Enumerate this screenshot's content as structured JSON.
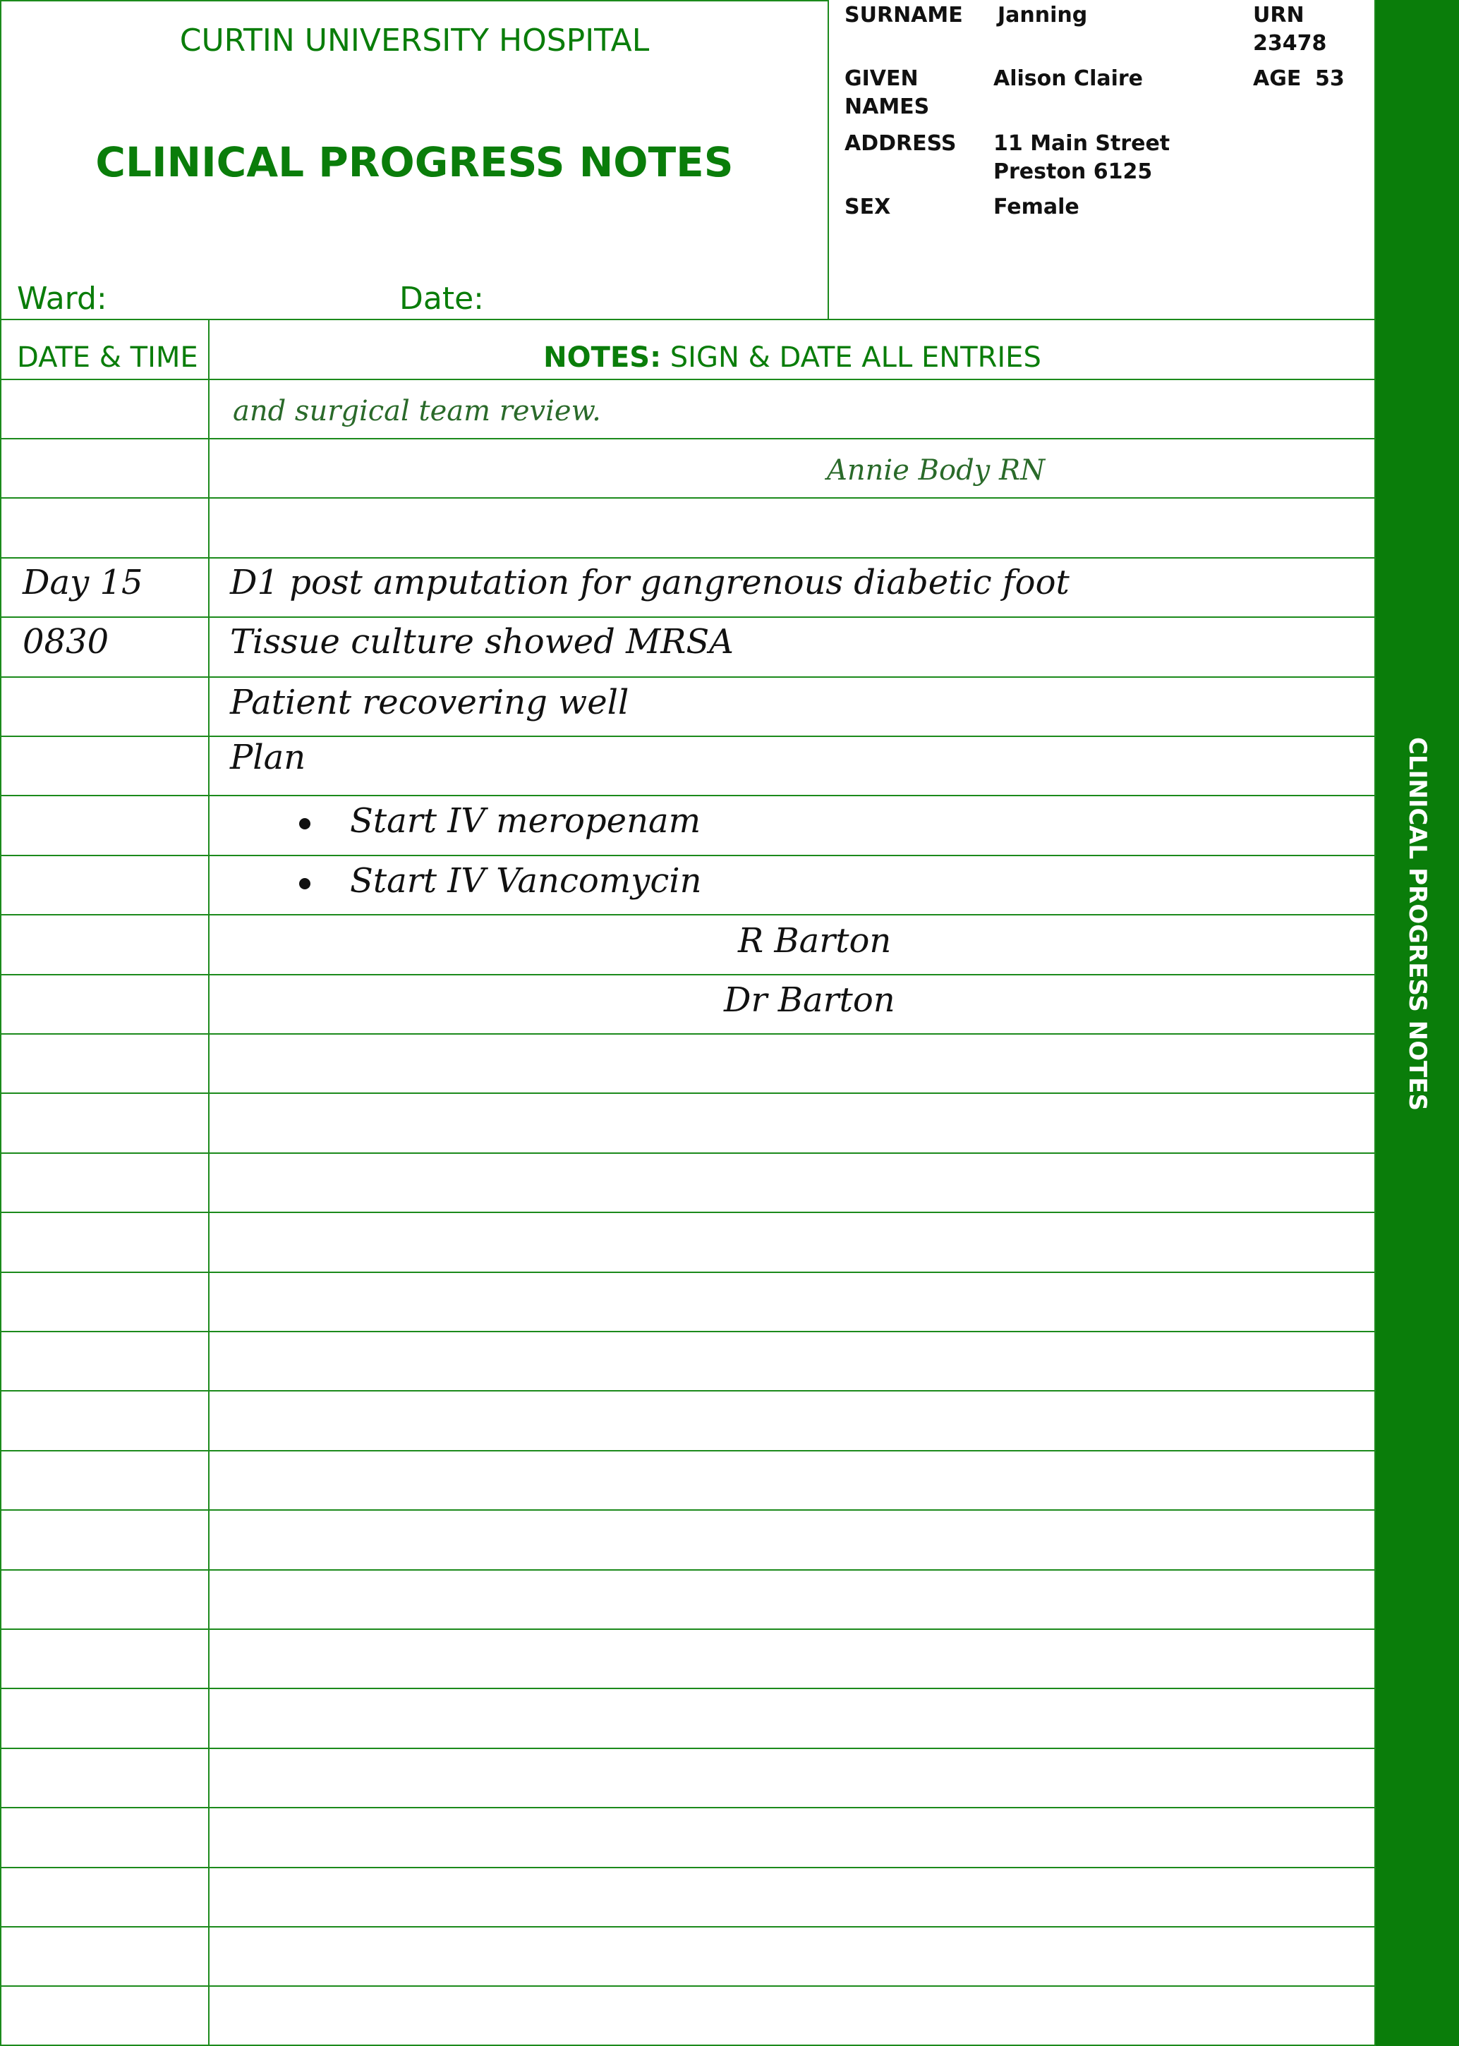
{
  "header": {
    "hospital_name": "CURTIN UNIVERSITY HOSPITAL",
    "form_title": "CLINICAL PROGRESS NOTES",
    "ward_label": "Ward:",
    "date_label": "Date:"
  },
  "patient": {
    "surname_label": "SURNAME",
    "surname": "Janning",
    "urn_label": "URN",
    "urn": "23478",
    "given_names_label_1": "GIVEN",
    "given_names_label_2": "NAMES",
    "given_names": "Alison Claire",
    "age_label": "AGE",
    "age": "53",
    "address_label": "ADDRESS",
    "address_line1": "11 Main Street",
    "address_line2": "Preston 6125",
    "sex_label": "SEX",
    "sex": "Female"
  },
  "columns": {
    "date_time": "DATE & TIME",
    "notes_bold": "NOTES:",
    "notes_rest": " SIGN & DATE ALL ENTRIES"
  },
  "entries": {
    "nurse_note": "and surgical team review.",
    "nurse_signature": "Annie Body RN",
    "day": "Day 15",
    "time": "0830",
    "line1": "D1 post amputation for gangrenous diabetic foot",
    "line2": "Tissue culture showed MRSA",
    "line3": "Patient recovering well",
    "plan": "Plan",
    "plan_items": [
      "Start IV meropenam",
      "Start IV Vancomycin"
    ],
    "doctor_signature": "R Barton",
    "doctor_name": "Dr Barton"
  },
  "sidebar": {
    "label": "CLINICAL PROGRESS NOTES"
  },
  "colors": {
    "brand_green": "#0a7d0a"
  }
}
